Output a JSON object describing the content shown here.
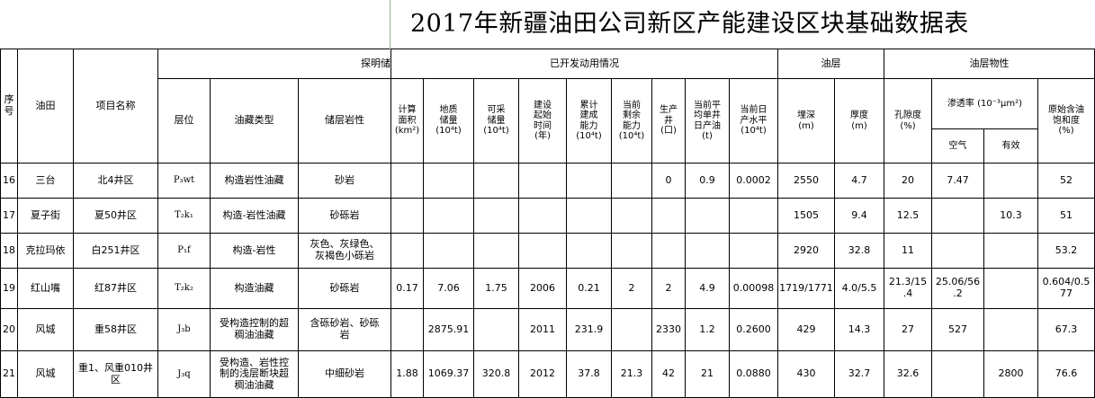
{
  "title": "2017年新疆油田公司新区产能建设区块基础数据表",
  "header": {
    "seq": "序\n号",
    "field": "油田",
    "project": "项目名称",
    "group_reserve": "探明储",
    "group_dev": "已开发动用情况",
    "group_layer": "油层",
    "group_props": "油层物性",
    "layer": "层位",
    "reservoir_type": "油藏类型",
    "lithology": "储层岩性",
    "area": "计算\n面积\n(km²)",
    "geo_reserve": "地质\n储量\n(10⁴t)",
    "rec_reserve": "可采\n储量\n(10⁴t)",
    "start_time": "建设\n起始\n时间\n(年)",
    "built_capacity": "累计\n建成\n能力\n(10⁴t)",
    "remaining_capacity": "当前\n剩余\n能力\n(10⁴t)",
    "wells": "生产\n井\n(口)",
    "avg_daily_oil": "当前平\n均单井\n日产油\n(t)",
    "daily_water": "当前日\n产水平\n(10⁴t)",
    "depth": "埋深\n(m)",
    "thickness": "厚度\n(m)",
    "porosity": "孔隙度\n(%)",
    "permeability": "渗透率 (10⁻³μm²)",
    "perm_air": "空气",
    "perm_effective": "有效",
    "oil_saturation": "原始含油\n饱和度\n(%)"
  },
  "rows": [
    {
      "seq": "16",
      "field": "三台",
      "project": "北4井区",
      "layer": "P₃wt",
      "type": "构造岩性油藏",
      "lith": "砂岩",
      "area": "",
      "geo": "",
      "rec": "",
      "start": "",
      "built": "",
      "remain": "",
      "wells": "0",
      "avg_oil": "0.9",
      "water": "0.0002",
      "depth": "2550",
      "thick": "4.7",
      "poro": "20",
      "perm_air": "7.47",
      "perm_eff": "",
      "sat": "52"
    },
    {
      "seq": "17",
      "field": "夏子街",
      "project": "夏50井区",
      "layer": "T₂k₁",
      "type": "构造-岩性油藏",
      "lith": "砂砾岩",
      "area": "",
      "geo": "",
      "rec": "",
      "start": "",
      "built": "",
      "remain": "",
      "wells": "",
      "avg_oil": "",
      "water": "",
      "depth": "1505",
      "thick": "9.4",
      "poro": "12.5",
      "perm_air": "",
      "perm_eff": "10.3",
      "sat": "51"
    },
    {
      "seq": "18",
      "field": "克拉玛依",
      "project": "白251井区",
      "layer": "P₁f",
      "type": "构造-岩性",
      "lith": "灰色、灰绿色、\n灰褐色小砾岩",
      "area": "",
      "geo": "",
      "rec": "",
      "start": "",
      "built": "",
      "remain": "",
      "wells": "",
      "avg_oil": "",
      "water": "",
      "depth": "2920",
      "thick": "32.8",
      "poro": "11",
      "perm_air": "",
      "perm_eff": "",
      "sat": "53.2"
    },
    {
      "seq": "19",
      "field": "红山嘴",
      "project": "红87井区",
      "layer": "T₂k₂",
      "type": "构造油藏",
      "lith": "砂砾岩",
      "area": "0.17",
      "geo": "7.06",
      "rec": "1.75",
      "start": "2006",
      "built": "0.21",
      "remain": "2",
      "wells": "2",
      "avg_oil": "4.9",
      "water": "0.00098",
      "depth": "1719/1771",
      "thick": "4.0/5.5",
      "poro": "21.3/15\n.4",
      "perm_air": "25.06/56\n.2",
      "perm_eff": "",
      "sat": "0.604/0.5\n77"
    },
    {
      "seq": "20",
      "field": "风城",
      "project": "重58井区",
      "layer": "J₃b",
      "type": "受构造控制的超\n稠油油藏",
      "lith": "含砾砂岩、砂砾\n岩",
      "area": "",
      "geo": "2875.91",
      "rec": "",
      "start": "2011",
      "built": "231.9",
      "remain": "",
      "wells": "2330",
      "avg_oil": "1.2",
      "water": "0.2600",
      "depth": "429",
      "thick": "14.3",
      "poro": "27",
      "perm_air": "527",
      "perm_eff": "",
      "sat": "67.3"
    },
    {
      "seq": "21",
      "field": "风城",
      "project": "重1、风重010井\n区",
      "layer": "J₃q",
      "type": "受构造、岩性控\n制的浅层断块超\n稠油油藏",
      "lith": "中细砂岩",
      "area": "1.88",
      "geo": "1069.37",
      "rec": "320.8",
      "start": "2012",
      "built": "37.8",
      "remain": "21.3",
      "wells": "42",
      "avg_oil": "21",
      "water": "0.0880",
      "depth": "430",
      "thick": "32.7",
      "poro": "32.6",
      "perm_air": "",
      "perm_eff": "2800",
      "sat": "76.6"
    }
  ]
}
